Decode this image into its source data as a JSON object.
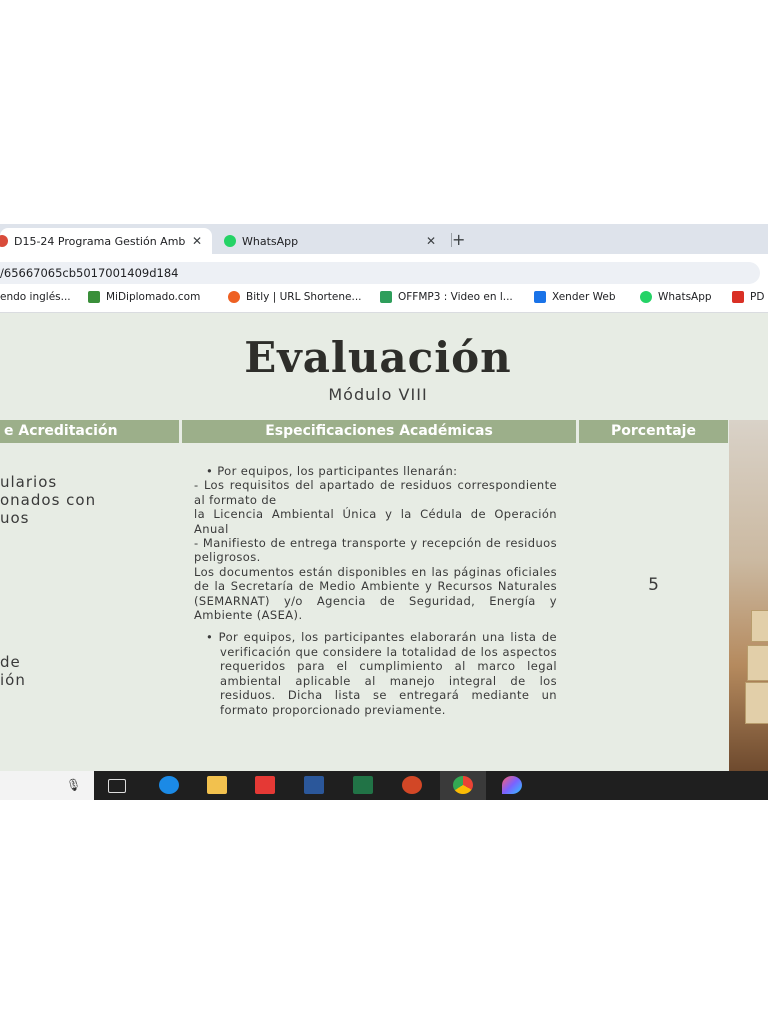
{
  "browser": {
    "tabs": [
      {
        "title": "D15-24 Programa Gestión Amb",
        "close": "✕"
      },
      {
        "title": "WhatsApp",
        "close": "✕"
      }
    ],
    "new_tab": "+",
    "url": "/65667065cb5017001409d184",
    "bookmarks": [
      {
        "label": "endo inglés...",
        "icon_color": ""
      },
      {
        "label": "MiDiplomado.com",
        "icon_color": "#3a8f3a"
      },
      {
        "label": "Bitly | URL Shortene...",
        "icon_color": "#ee6123"
      },
      {
        "label": "OFFMP3 : Video en l...",
        "icon_color": "#2e9e5b"
      },
      {
        "label": "Xender Web",
        "icon_color": "#1a73e8"
      },
      {
        "label": "WhatsApp",
        "icon_color": "#25d366"
      },
      {
        "label": "PD",
        "icon_color": "#d93025"
      }
    ]
  },
  "slide": {
    "title": "Evaluación",
    "subtitle": "Módulo VIII",
    "headers": {
      "col1": "e Acreditación",
      "col2": "Especificaciones Académicas",
      "col3": "Porcentaje"
    },
    "col1_a": "ularios\nonados con\nuos",
    "col1_b": "de\nión",
    "spec": {
      "p1": "• Por equipos, los participantes llenarán:",
      "p2": "- Los requisitos del apartado de residuos correspondiente al formato de",
      "p3": "la Licencia Ambiental Única y la Cédula de Operación Anual",
      "p4": "- Manifiesto de entrega transporte y recepción de residuos peligrosos.",
      "p5": "Los documentos están disponibles en las páginas oficiales de la Secretaría de Medio Ambiente y Recursos Naturales (SEMARNAT) y/o Agencia de Seguridad, Energía y Ambiente (ASEA).",
      "p6": "• Por equipos, los participantes elaborarán una lista de verificación que considere la totalidad de los aspectos requeridos para el cumplimiento al marco legal ambiental aplicable al manejo integral de los residuos. Dicha lista se entregará mediante un formato proporcionado previamente."
    },
    "percentage": "5"
  },
  "taskbar": {
    "mic_icon": "🎙",
    "apps": [
      {
        "name": "task-view",
        "color": "#1f1f1f"
      },
      {
        "name": "edge",
        "color": "#1b8ae6"
      },
      {
        "name": "file-explorer",
        "color": "#f2c14e"
      },
      {
        "name": "hi-app",
        "color": "#e53935"
      },
      {
        "name": "word",
        "color": "#2b579a"
      },
      {
        "name": "excel",
        "color": "#217346"
      },
      {
        "name": "powerpoint",
        "color": "#d24726"
      },
      {
        "name": "chrome",
        "color": "#4caf50"
      },
      {
        "name": "paint3d",
        "color": "#7b61ff"
      }
    ]
  }
}
